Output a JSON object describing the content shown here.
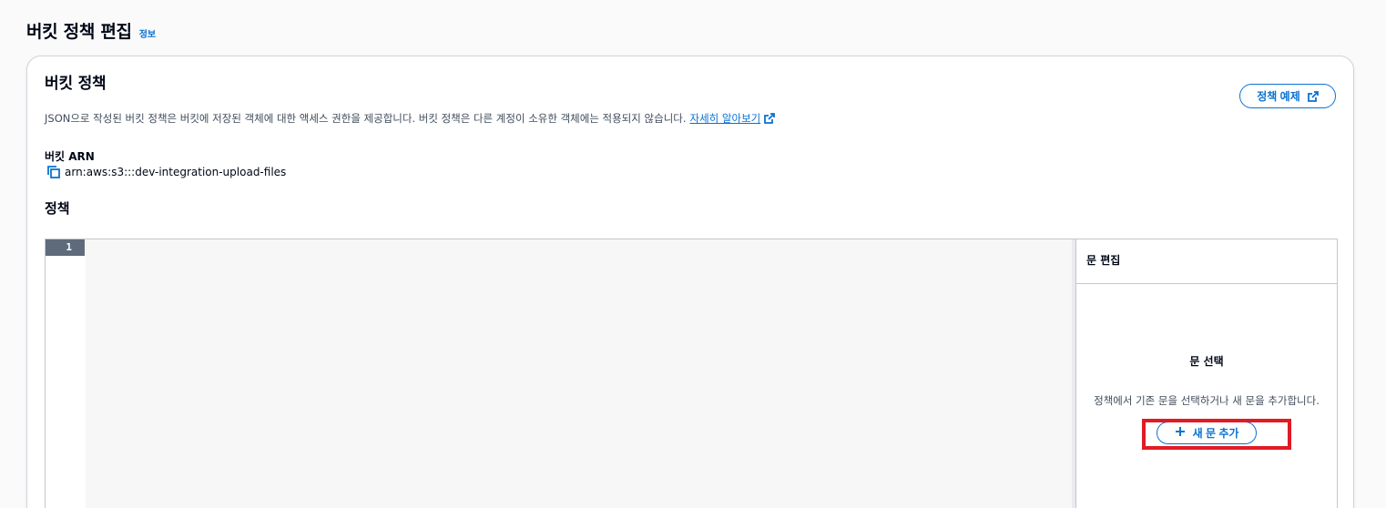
{
  "header": {
    "title": "버킷 정책 편집",
    "info_label": "정보"
  },
  "card": {
    "title": "버킷 정책",
    "examples_button_label": "정책 예제",
    "description": "JSON으로 작성된 버킷 정책은 버킷에 저장된 객체에 대한 액세스 권한을 제공합니다. 버킷 정책은 다른 계정이 소유한 객체에는 적용되지 않습니다.",
    "learn_more_label": "자세히 알아보기",
    "arn_label": "버킷 ARN",
    "arn_value": "arn:aws:s3:::dev-integration-upload-files",
    "policy_label": "정책"
  },
  "editor": {
    "line_numbers": [
      "1"
    ],
    "code": ""
  },
  "side_panel": {
    "title": "문 편집",
    "empty_title": "문 선택",
    "empty_description": "정책에서 기존 문을 선택하거나 새 문을 추가합니다.",
    "add_button_label": "새 문 추가"
  },
  "colors": {
    "accent": "#0972d3",
    "highlight": "#e01b24",
    "gutter_active": "#5f6b7a"
  },
  "icons": {
    "external_link": "external-link-icon",
    "copy": "copy-icon",
    "add": "plus-icon"
  }
}
